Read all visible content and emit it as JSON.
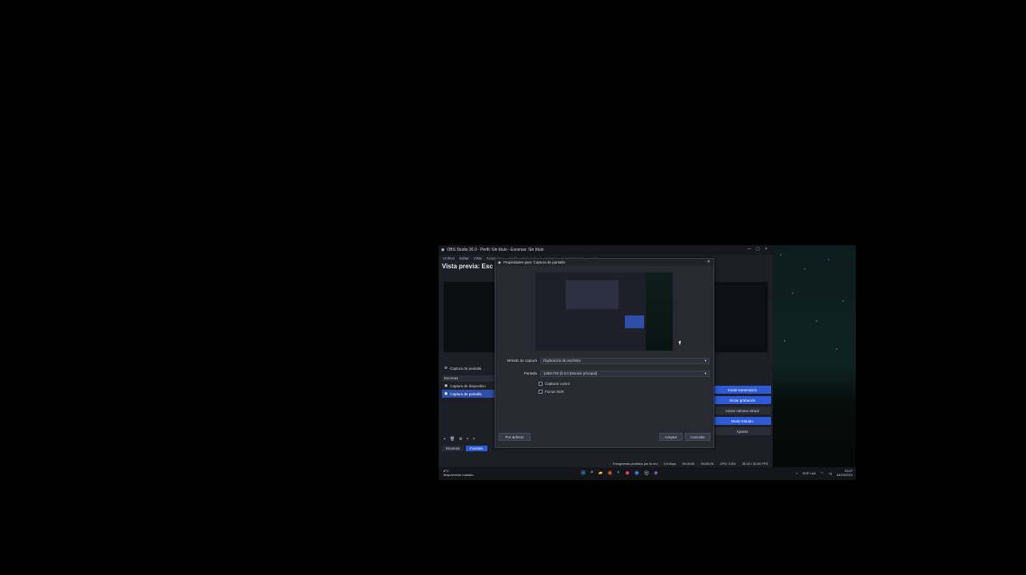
{
  "obs": {
    "window_title": "OBS Studio 30.0 - Perfil: Sin título - Escenas: Sin título",
    "menu": [
      "Archivo",
      "Editar",
      "Vista",
      "Acoplables",
      "Perfil",
      "Colección de escenas",
      "Herramientas",
      "Ayuda"
    ],
    "preview_title": "Vista previa: Esc",
    "zoom_label": "0%",
    "source_bar_label": "Captura de pantalla",
    "panel_header": "Escenas",
    "sources": [
      {
        "label": "Captura de dispositivo",
        "selected": false
      },
      {
        "label": "Captura de pantalla",
        "selected": true
      }
    ],
    "tabs": [
      {
        "label": "Escenas",
        "active": false
      },
      {
        "label": "Fuentes",
        "active": true
      }
    ],
    "controls": [
      {
        "label": "Iniciar transmisión",
        "style": "blue"
      },
      {
        "label": "Iniciar grabación",
        "style": "blue"
      },
      {
        "label": "Iniciar cámara virtual",
        "style": "dark"
      },
      {
        "label": "Modo Estudio",
        "style": "blue"
      },
      {
        "label": "Ajustes",
        "style": "dark"
      }
    ],
    "status": [
      "Fotogramas perdidos por la red",
      "0.0 kbps",
      "00:00:00",
      "00:00:00",
      "CPU: 0.3%",
      "30.00 / 30.00 FPS"
    ]
  },
  "dialog": {
    "title": "Propiedades para 'Captura de pantalla'",
    "method_label": "Método de captura",
    "method_value": "Duplicación de escritorio",
    "display_label": "Pantalla",
    "display_value": "1284x720 @ 0,0 (Monitor principal)",
    "checkbox_cursor": "Capturar cursor",
    "checkbox_srgb": "Forzar SDR",
    "defaults_button": "Por defecto",
    "accept_button": "Aceptar",
    "cancel_button": "Cancelar"
  },
  "taskbar": {
    "weather_temp": "8°C",
    "weather_text": "Mayormente nublado",
    "lang": "ESP LAA",
    "time": "23:07",
    "date": "04/04/2024"
  }
}
